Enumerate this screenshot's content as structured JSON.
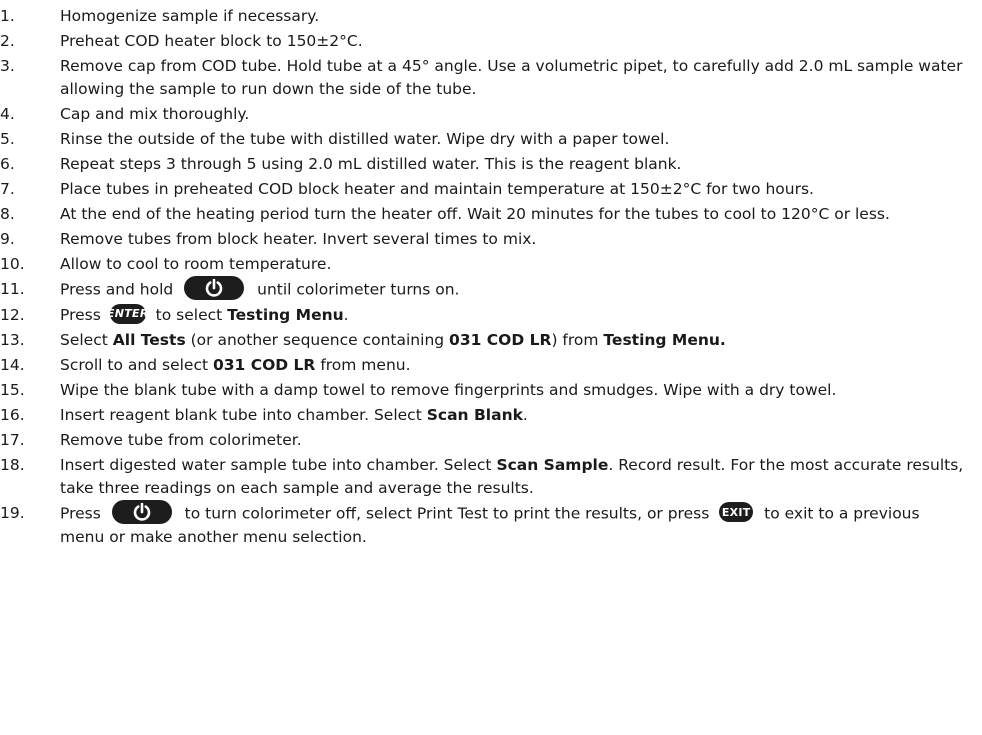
{
  "steps": [
    {
      "n": "1.",
      "text": "Homogenize sample if necessary."
    },
    {
      "n": "2.",
      "text": "Preheat COD heater block to 150±2°C."
    },
    {
      "n": "3.",
      "text": "Remove cap from COD tube. Hold tube at a 45° angle. Use a volumetric pipet, to carefully add 2.0 mL sample water allowing the sample to run down the side of the tube."
    },
    {
      "n": "4.",
      "text": "Cap and mix thoroughly."
    },
    {
      "n": "5.",
      "text": "Rinse the outside of the tube with distilled water. Wipe dry with a paper towel."
    },
    {
      "n": "6.",
      "text": "Repeat steps 3 through 5 using 2.0 mL distilled water. This is the reagent blank."
    },
    {
      "n": "7.",
      "text": "Place tubes in preheated COD block heater and maintain temperature at 150±2°C for two hours."
    },
    {
      "n": "8.",
      "text": "At the end of the heating period turn the heater off. Wait 20 minutes for the tubes to cool to 120°C or less."
    },
    {
      "n": "9.",
      "text": "Remove tubes from block heater. Invert several times to mix."
    },
    {
      "n": "10.",
      "text": "Allow to cool to room temperature."
    },
    {
      "n": "11.",
      "a": "Press and hold",
      "b": "until colorimeter turns on."
    },
    {
      "n": "12.",
      "a": "Press",
      "b": "to select",
      "c": "Testing Menu",
      "d": "."
    },
    {
      "n": "13.",
      "a": "Select",
      "b": "All Tests",
      "c": "(or another sequence containing",
      "d": "031 COD LR",
      "e": ") from",
      "f": "Testing Menu."
    },
    {
      "n": "14.",
      "a": "Scroll to and select",
      "b": "031 COD LR",
      "c": "from menu."
    },
    {
      "n": "15.",
      "text": "Wipe the blank tube with a damp towel to remove fingerprints and smudges. Wipe with a dry towel."
    },
    {
      "n": "16.",
      "a": "Insert reagent blank tube into chamber. Select",
      "b": "Scan Blank",
      "c": "."
    },
    {
      "n": "17.",
      "text": "Remove tube from colorimeter."
    },
    {
      "n": "18.",
      "a": "Insert digested water sample tube into chamber. Select",
      "b": "Scan Sample",
      "c": ". Record result. For the most accurate results, take three readings on each sample and average the results."
    },
    {
      "n": "19.",
      "a": "Press",
      "b": "to turn colorimeter off, select Print Test to print the results, or press",
      "c": "to exit to a previous menu or make another menu selection."
    }
  ],
  "buttons": {
    "enter_label": "ENTER",
    "exit_label": "EXIT"
  },
  "icons": [
    "power-icon",
    "enter-button-icon",
    "exit-button-icon"
  ],
  "colors": {
    "text": "#1a1a1a",
    "button_fill": "#1d1d1d",
    "button_text": "#ffffff"
  }
}
